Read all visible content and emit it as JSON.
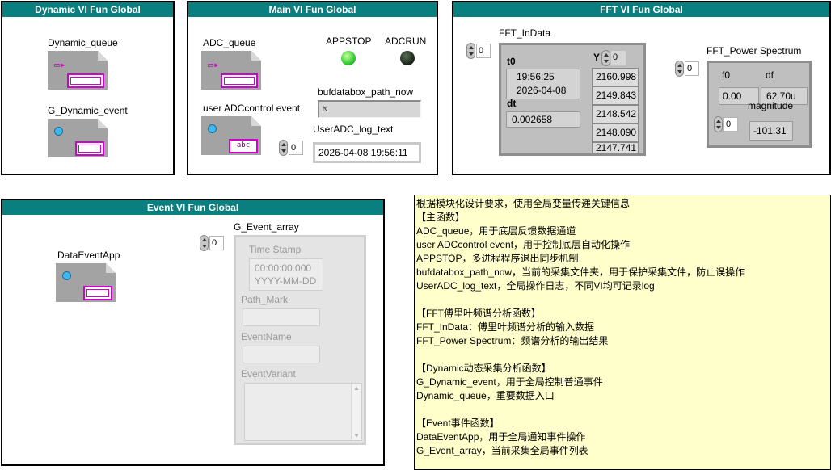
{
  "panels": {
    "dynamic": {
      "title": "Dynamic VI Fun Global",
      "dynamic_queue_label": "Dynamic_queue",
      "g_dynamic_event_label": "G_Dynamic_event"
    },
    "main": {
      "title": "Main VI Fun Global",
      "adc_queue_label": "ADC_queue",
      "appstop_label": "APPSTOP",
      "adcrun_label": "ADCRUN",
      "appstop_state": "on",
      "adcrun_state": "off",
      "bufdatabox_label": "bufdatabox_path_now",
      "bufdatabox_value": "",
      "user_adc_event_label": "user ADCcontrol event",
      "useradc_log_label": "UserADC_log_text",
      "useradc_log_index": "0",
      "useradc_log_value": "2026-04-08 19:56:11",
      "user_adc_event_tag": "abc"
    },
    "fft": {
      "title": "FFT VI Fun Global",
      "indata_label": "FFT_InData",
      "indata_index": "0",
      "t0_label": "t0",
      "t0_time": "19:56:25",
      "t0_date": "2026-04-08",
      "dt_label": "dt",
      "dt_value": "0.002658",
      "y_label": "Y",
      "y_index": "0",
      "y_values": [
        "2160.998",
        "2149.843",
        "2148.542",
        "2148.090",
        "2147.741"
      ],
      "power_label": "FFT_Power Spectrum",
      "power_index": "0",
      "f0_label": "f0",
      "f0_value": "0.00",
      "df_label": "df",
      "df_value": "62.70u",
      "magnitude_label": "magnitude",
      "magnitude_index": "0",
      "magnitude_value": "-101.31"
    },
    "event": {
      "title": "Event VI Fun Global",
      "data_event_label": "DataEventApp",
      "g_event_array_label": "G_Event_array",
      "g_event_index": "0",
      "timestamp_label": "Time Stamp",
      "timestamp_time": "00:00:00.000",
      "timestamp_date": "YYYY-MM-DD",
      "path_mark_label": "Path_Mark",
      "event_name_label": "EventName",
      "event_variant_label": "EventVariant"
    }
  },
  "notes": [
    "根据模块化设计要求，使用全局变量传递关键信息",
    "【主函数】",
    "ADC_queue，用于底层反馈数据通道",
    "user ADCcontrol event，用于控制底层自动化操作",
    "APPSTOP，多进程程序退出同步机制",
    "bufdatabox_path_now，当前的采集文件夹，用于保护采集文件，防止误操作",
    "UserADC_log_text，全局操作日志，不同VI均可记录log",
    "",
    "【FFT傅里叶频谱分析函数】",
    "FFT_InData：傅里叶频谱分析的输入数据",
    "FFT_Power Spectrum：频谱分析的输出结果",
    "",
    "【Dynamic动态采集分析函数】",
    "G_Dynamic_event，用于全局控制普通事件",
    "Dynamic_queue，重要数据入口",
    "",
    "【Event事件函数】",
    "DataEventApp，用于全局通知事件操作",
    "G_Event_array，当前采集全局事件列表"
  ],
  "colors": {
    "title_bar": "#0a7f7f",
    "notes_bg": "#ffffcc",
    "led_on": "#3bd13b",
    "led_off": "#1d2b1b",
    "ref_wire": "#d000d0"
  }
}
